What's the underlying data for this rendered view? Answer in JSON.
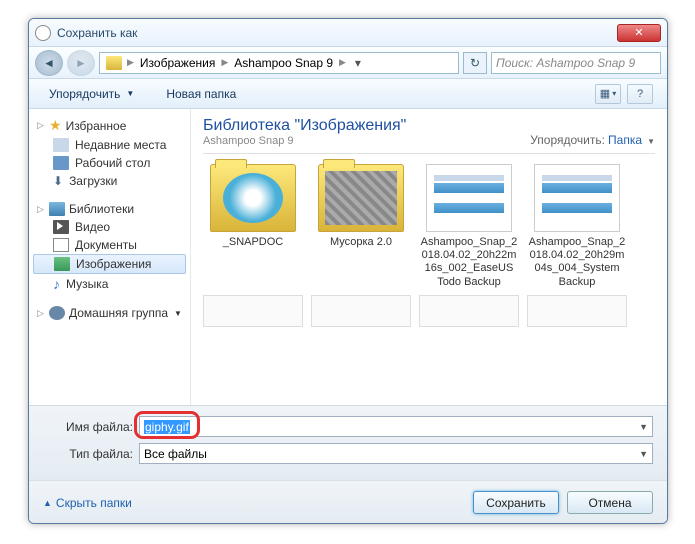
{
  "window": {
    "title": "Сохранить как"
  },
  "nav": {
    "crumb1": "Изображения",
    "crumb2": "Ashampoo Snap 9",
    "search_placeholder": "Поиск: Ashampoo Snap 9"
  },
  "toolbar": {
    "organize": "Упорядочить",
    "new_folder": "Новая папка"
  },
  "sidebar": {
    "favorites": "Избранное",
    "recent": "Недавние места",
    "desktop": "Рабочий стол",
    "downloads": "Загрузки",
    "libraries": "Библиотеки",
    "videos": "Видео",
    "documents": "Документы",
    "pictures": "Изображения",
    "music": "Музыка",
    "homegroup": "Домашняя группа"
  },
  "content": {
    "lib_title": "Библиотека \"Изображения\"",
    "lib_sub": "Ashampoo Snap 9",
    "sort_label": "Упорядочить:",
    "sort_value": "Папка",
    "items": [
      "_SNAPDOC",
      "Мусорка 2.0",
      "Ashampoo_Snap_2018.04.02_20h22m16s_002_EaseUS Todo Backup",
      "Ashampoo_Snap_2018.04.02_20h29m04s_004_System Backup"
    ]
  },
  "fields": {
    "filename_label": "Имя файла:",
    "filename_value": "giphy.gif",
    "filetype_label": "Тип файла:",
    "filetype_value": "Все файлы"
  },
  "bottom": {
    "hide_folders": "Скрыть папки",
    "save": "Сохранить",
    "cancel": "Отмена"
  }
}
